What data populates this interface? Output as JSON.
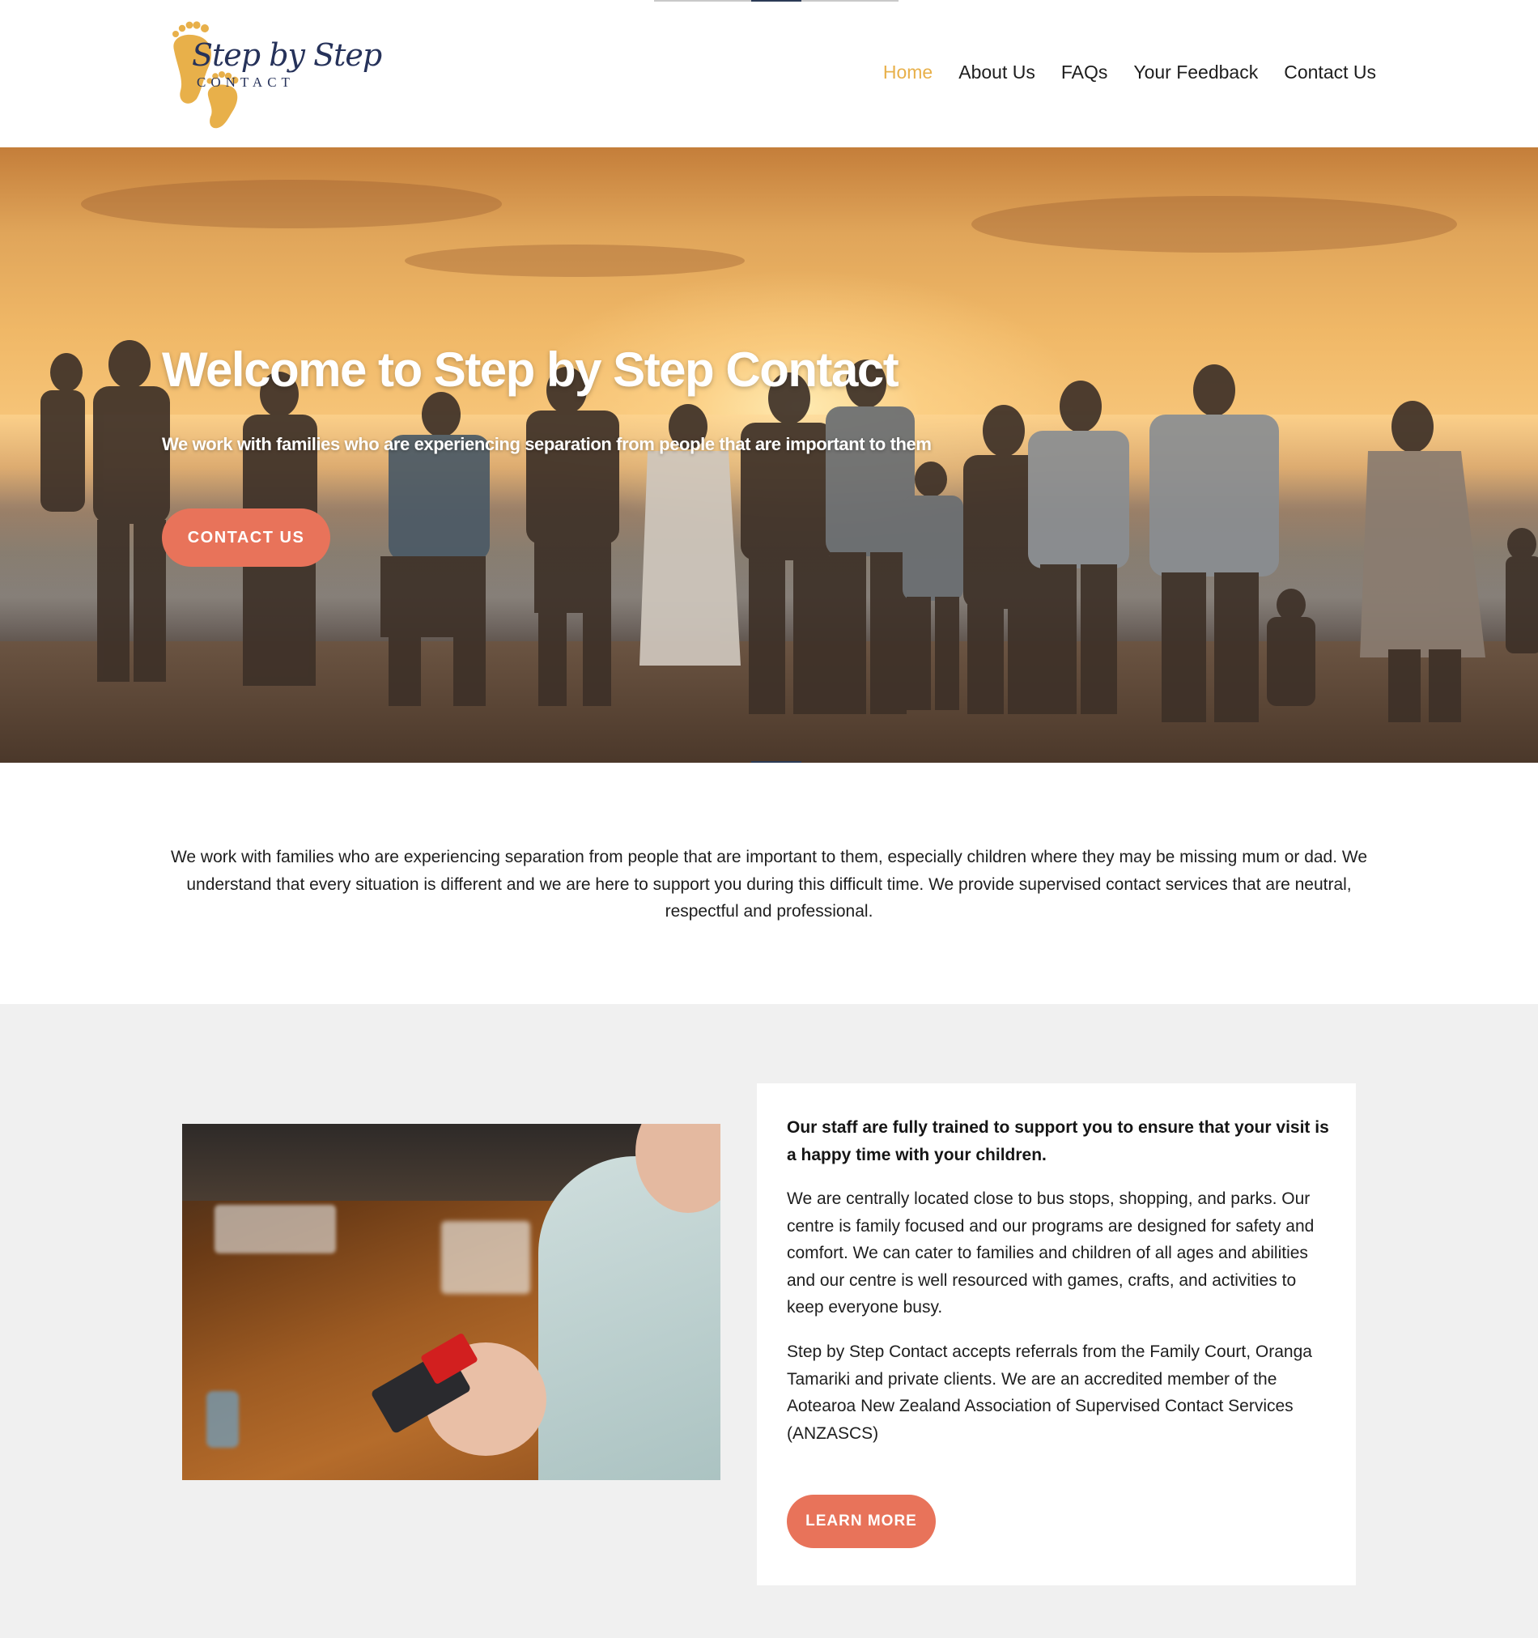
{
  "header": {
    "logo": {
      "script": "Step by Step",
      "sub": "CONTACT",
      "accent_color": "#e8b04a",
      "text_color": "#26325a"
    },
    "nav": [
      {
        "label": "Home",
        "active": true
      },
      {
        "label": "About Us",
        "active": false
      },
      {
        "label": "FAQs",
        "active": false
      },
      {
        "label": "Your Feedback",
        "active": false
      },
      {
        "label": "Contact Us",
        "active": false
      }
    ],
    "active_color": "#e8b04a"
  },
  "hero": {
    "title": "Welcome to Step by Step Contact",
    "subtitle": "We work with families who are experiencing separation from people that are important to them",
    "cta_label": "CONTACT US",
    "cta_color": "#e8735a"
  },
  "intro": {
    "text": "We work with families who are experiencing separation from people that are important to them, especially children where they may be missing mum or dad. We understand that every situation is different and we are here to support you during this difficult time. We provide supervised contact services that are neutral, respectful and professional."
  },
  "feature": {
    "lead": "Our staff are fully trained to support you to ensure that your visit is a happy time with your children.",
    "paragraph1": "We are centrally located close to bus stops, shopping, and parks. Our centre is family focused and our programs are designed for safety and comfort. We can cater to families and children of all ages and abilities and our centre is well resourced with games, crafts, and activities to keep everyone busy.",
    "paragraph2": "Step by Step Contact accepts referrals from the Family Court, Oranga Tamariki and private clients. We are an accredited member of the Aotearoa New Zealand Association of Supervised Contact Services (ANZASCS)",
    "button_label": "LEARN MORE",
    "background": "#f0f0f0"
  }
}
